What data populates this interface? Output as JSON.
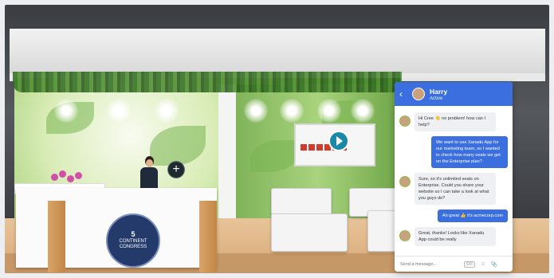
{
  "logo": {
    "line1": "5",
    "line2": "CONTINENT",
    "line3": "CONGRESS"
  },
  "hotspot": {
    "symbol": "+"
  },
  "chat": {
    "back_icon": "chevron-left-icon",
    "agent_name": "Harry",
    "agent_status": "Active",
    "messages": [
      {
        "from": "agent",
        "text": "Hi Cree 👋 no problem! how can I help?"
      },
      {
        "from": "user",
        "text": "We want to use Xanadu App for our marketing team, so I wanted to check how many seats we get on the Enterprise plan?"
      },
      {
        "from": "agent",
        "text": "Sure, so it's unlimited seats on Enterprise. Could you share your website so I can take a look at what you guys do?"
      },
      {
        "from": "user",
        "text": "Ah great 👍 it's acmecorp.com"
      },
      {
        "from": "agent",
        "text": "Great, thanks! Looks like Xanadu App could be really"
      }
    ],
    "composer": {
      "placeholder": "Send a message...",
      "gif_label": "GIF",
      "emoji_icon": "☺",
      "attach_icon": "📎"
    },
    "accent": "#3b6fe0"
  }
}
